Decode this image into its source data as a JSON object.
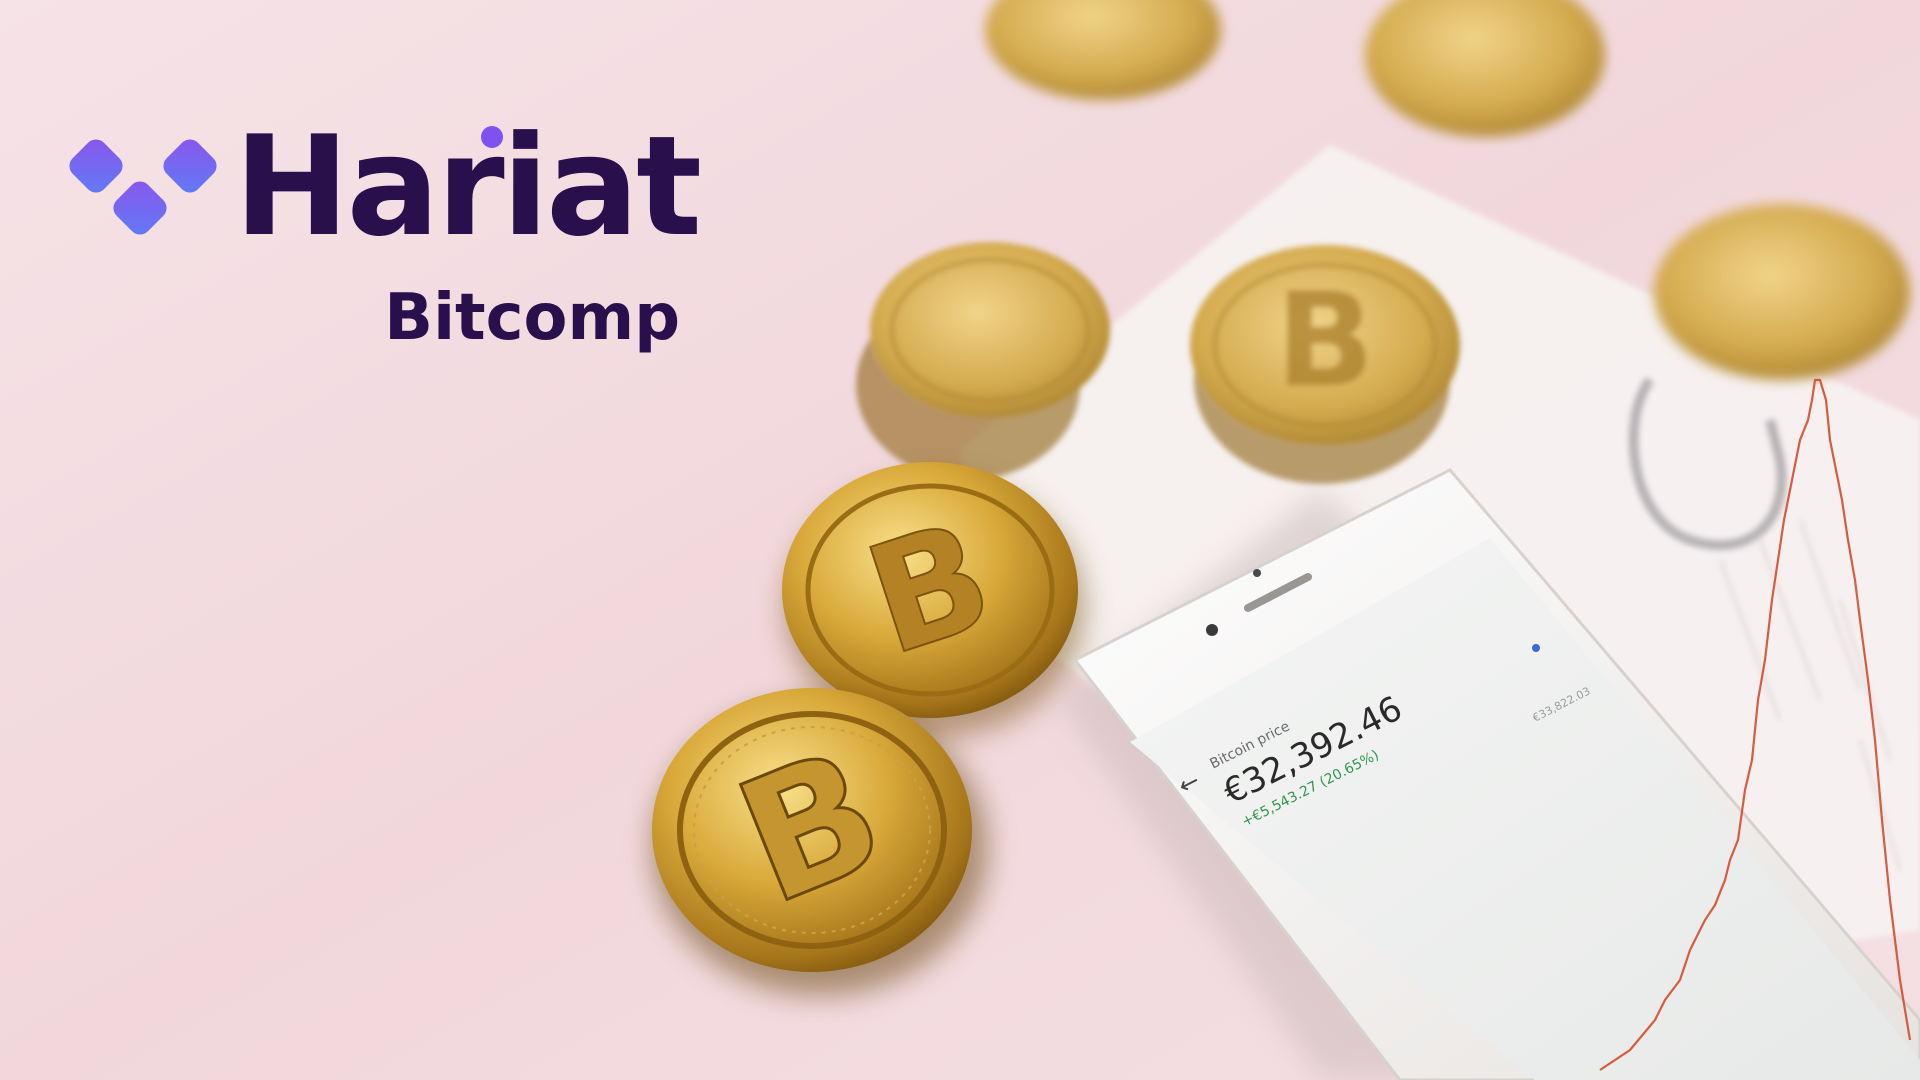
{
  "brand": {
    "name": "Hariat",
    "product": "Bitcomp",
    "colors": {
      "wordmark": "#2a0f4d",
      "logo_gradient_start": "#8b55ec",
      "logo_gradient_end": "#5f7cf5",
      "accent_dot": "#7d52ee"
    }
  },
  "photo": {
    "background_color": "#f3dde2",
    "phone_screen": {
      "label": "Bitcoin price",
      "price": "€32,392.46",
      "change": "+€5,543.27 (20.65%)",
      "chart_label": "€33,822.03"
    }
  }
}
